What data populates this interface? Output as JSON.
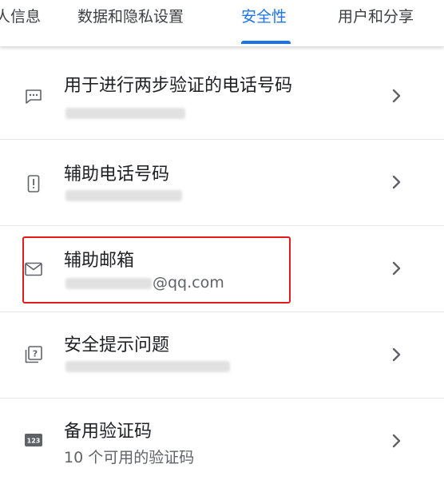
{
  "tabs": [
    {
      "label": "人信息"
    },
    {
      "label": "数据和隐私设置"
    },
    {
      "label": "安全性",
      "active": true
    },
    {
      "label": "用户和分享"
    }
  ],
  "accent_color": "#1a73e8",
  "highlight_color": "#e21b1b",
  "rows": [
    {
      "icon": "message-dots-icon",
      "title": "用于进行两步验证的电话号码",
      "subtitle": "",
      "subtitle_blurred": true
    },
    {
      "icon": "phone-alert-icon",
      "title": "辅助电话号码",
      "subtitle": "",
      "subtitle_blurred": true
    },
    {
      "icon": "mail-icon",
      "title": "辅助邮箱",
      "subtitle": "@qq.com",
      "subtitle_prefix_blurred": true,
      "highlighted": true
    },
    {
      "icon": "question-box-icon",
      "title": "安全提示问题",
      "subtitle": "",
      "subtitle_blurred": true
    },
    {
      "icon": "123-badge-icon",
      "title": "备用验证码",
      "subtitle": "10 个可用的验证码"
    }
  ]
}
